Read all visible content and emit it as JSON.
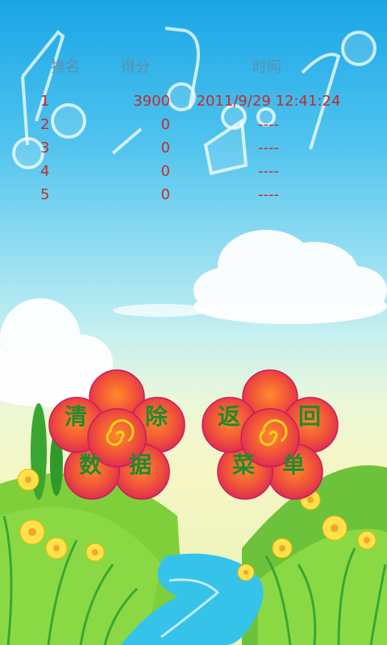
{
  "table": {
    "headers": {
      "rank": "排名",
      "score": "得分",
      "time": "时间"
    },
    "rows": [
      {
        "rank": "1",
        "score": "3900",
        "time": "2011/9/29 12:41:24"
      },
      {
        "rank": "2",
        "score": "0",
        "time": "----"
      },
      {
        "rank": "3",
        "score": "0",
        "time": "----"
      },
      {
        "rank": "4",
        "score": "0",
        "time": "----"
      },
      {
        "rank": "5",
        "score": "0",
        "time": "----"
      }
    ]
  },
  "buttons": {
    "clear": {
      "chars": [
        "清",
        "除",
        "数",
        "据"
      ]
    },
    "back": {
      "chars": [
        "返",
        "回",
        "菜",
        "单"
      ]
    }
  },
  "colors": {
    "score_text": "#c42b2b",
    "header_text": "#5d8fa8",
    "button_text": "#1f8a2f",
    "petal": "#e0453b"
  },
  "icons": [
    "music-note-icon",
    "spiral-icon"
  ]
}
